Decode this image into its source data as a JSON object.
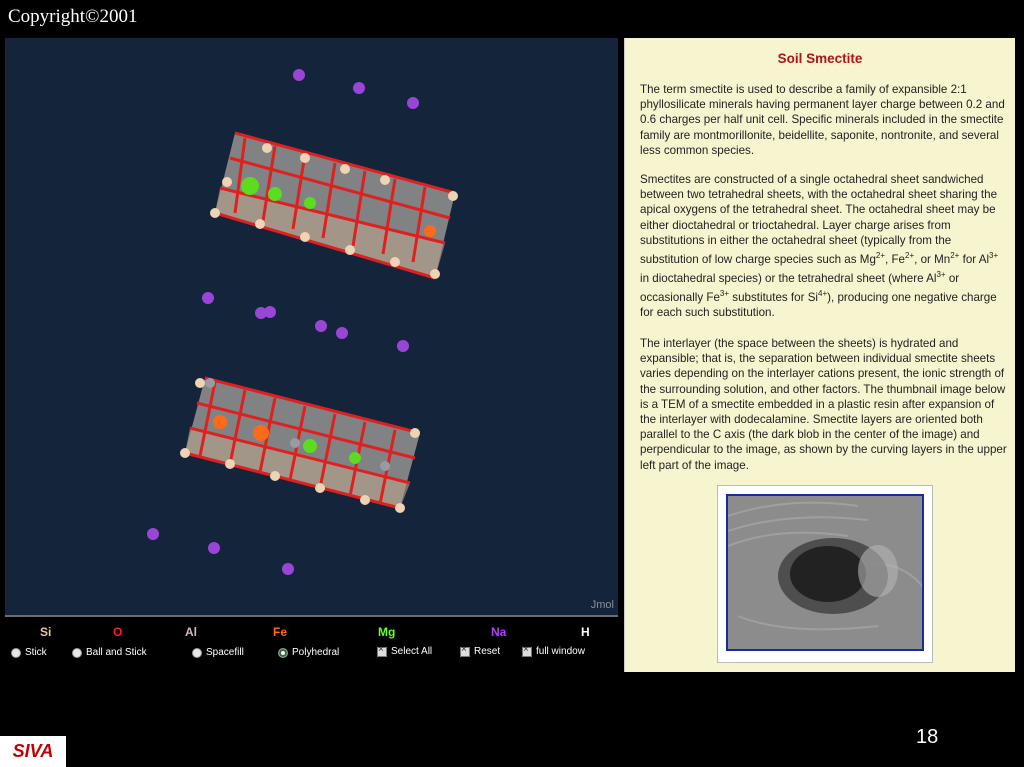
{
  "copyright": "Copyright©2001",
  "viewer": {
    "brand": "Jmol"
  },
  "legend": {
    "elements": [
      {
        "label": "Si",
        "color": "#e8c8a8"
      },
      {
        "label": "O",
        "color": "#ff2020"
      },
      {
        "label": "Al",
        "color": "#d0b8b8"
      },
      {
        "label": "Fe",
        "color": "#ff6a1a"
      },
      {
        "label": "Mg",
        "color": "#6cff20"
      },
      {
        "label": "Na",
        "color": "#b040ff"
      },
      {
        "label": "H",
        "color": "#ffffff"
      }
    ],
    "options": {
      "stick": "Stick",
      "ball_and_stick": "Ball and Stick",
      "spacefill": "Spacefill",
      "polyhedral": "Polyhedral",
      "select_all": "Select All",
      "reset": "Reset",
      "full_window": "full window"
    }
  },
  "panel": {
    "title": "Soil Smectite",
    "p1": "The term smectite is used to describe a family of expansible 2:1 phyllosilicate minerals having permanent layer charge between 0.2 and 0.6 charges per half unit cell. Specific minerals included in the smectite family are montmorillonite, beidellite, saponite, nontronite, and several less common species.",
    "p2a": "Smectites are constructed of a single octahedral sheet sandwiched between two tetrahedral sheets, with the octahedral sheet sharing the apical oxygens of the tetrahedral sheet. The octahedral sheet may be either dioctahedral or trioctahedral. Layer charge arises from substitutions in either the octahedral sheet (typically from the substitution of low charge species such as",
    "p2_mg": "Mg",
    "p2_mg_sup": "2+",
    "p2_fe": "Fe",
    "p2_fe_sup": "2+",
    "p2_or": ", or",
    "p2_mn": "Mn",
    "p2_mn_sup": "2+",
    "p2_for": "for",
    "p2_al": "Al",
    "p2_al_sup": "3+",
    "p2b": "in dioctahedral species) or the tetrahedral sheet (where",
    "p2_al2": "Al",
    "p2_al2_sup": "3+",
    "p2c": "or occasionally",
    "p2_fe3": "Fe",
    "p2_fe3_sup": "3+",
    "p2d": "substitutes for",
    "p2_si": "Si",
    "p2_si_sup": "4+",
    "p2e": "), producing one negative charge for each such substitution.",
    "p3": "The interlayer (the space between the sheets) is hydrated and expansible; that is, the separation between individual smectite sheets varies depending on the interlayer cations present, the ionic strength of the surrounding solution, and other factors. The thumbnail image below is a TEM of a smectite embedded in a plastic resin after expansion of the interlayer with dodecalamine. Smectite layers are oriented both parallel to the C axis (the dark blob in the center of the image) and perpendicular to the image, as shown by the curving layers in the upper left part of the image."
  },
  "slide_number": "18",
  "footer_logo": "SIVA"
}
